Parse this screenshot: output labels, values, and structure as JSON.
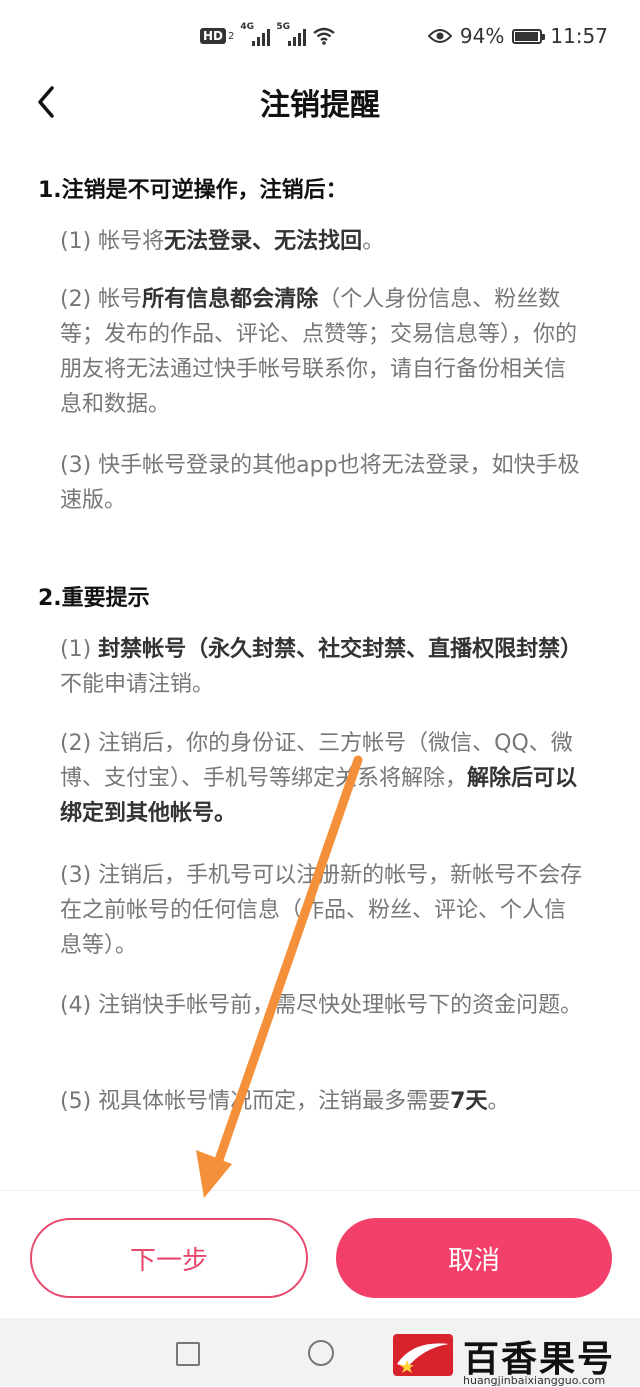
{
  "status_bar": {
    "hd": "HD",
    "hd_sub": "2",
    "net1": "4G",
    "net2": "5G",
    "battery_percent": "94%",
    "battery_level": 0.94,
    "time": "11:57"
  },
  "header": {
    "title": "注销提醒"
  },
  "section1": {
    "heading": "1.注销是不可逆操作，注销后：",
    "items": [
      {
        "pre": "(1) 帐号将",
        "bold": "无法登录、无法找回",
        "post": "。"
      },
      {
        "pre": "(2) 帐号",
        "bold": "所有信息都会清除",
        "post": "（个人身份信息、粉丝数等；发布的作品、评论、点赞等；交易信息等），你的朋友将无法通过快手帐号联系你，请自行备份相关信息和数据。"
      },
      {
        "text": "(3) 快手帐号登录的其他app也将无法登录，如快手极速版。"
      }
    ]
  },
  "section2": {
    "heading": "2.重要提示",
    "items": [
      {
        "pre": "(1) ",
        "bold": "封禁帐号（永久封禁、社交封禁、直播权限封禁）",
        "post": "不能申请注销。"
      },
      {
        "pre": "(2) 注销后，你的身份证、三方帐号（微信、QQ、微博、支付宝）、手机号等绑定关系将解除，",
        "bold": "解除后可以绑定到其他帐号。",
        "post": ""
      },
      {
        "text": "(3) 注销后，手机号可以注册新的帐号，新帐号不会存在之前帐号的任何信息（作品、粉丝、评论、个人信息等）。"
      },
      {
        "text": "(4) 注销快手帐号前，需尽快处理帐号下的资金问题。"
      },
      {
        "pre": "(5) 视具体帐号情况而定，注销最多需要",
        "bold": "7天",
        "post": "。"
      }
    ]
  },
  "buttons": {
    "next": "下一步",
    "cancel": "取消"
  },
  "colors": {
    "accent": "#f3406a",
    "arrow": "#f5903a"
  },
  "watermark": {
    "text": "百香果号",
    "url": "huangjinbaixiangguo.com"
  }
}
